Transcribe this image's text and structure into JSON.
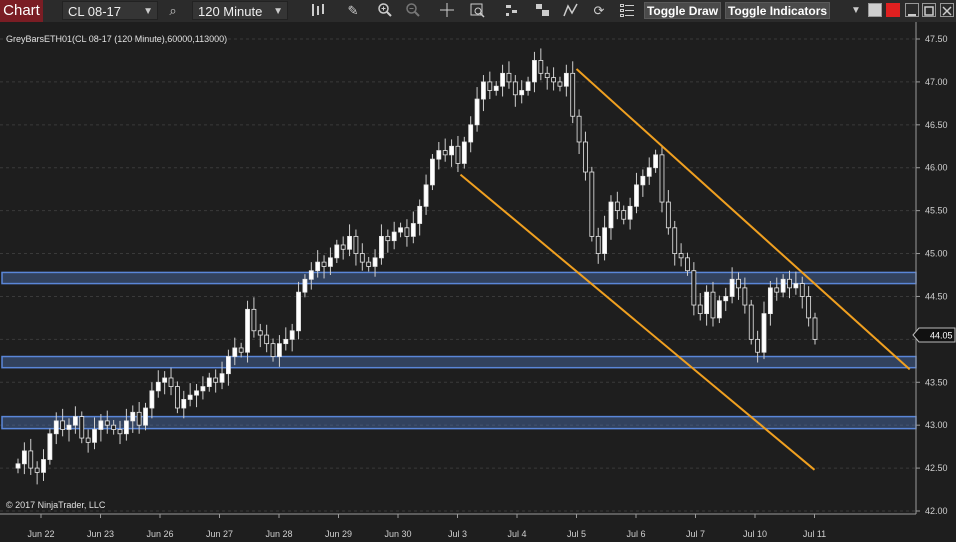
{
  "toolbar": {
    "title": "Chart",
    "instrument": "CL 08-17",
    "interval": "120 Minute",
    "toggle_draw_label": "Toggle Draw",
    "toggle_indicators_label": "Toggle Indicators"
  },
  "chart": {
    "info_label": "GreyBarsETH01(CL 08-17 (120 Minute),60000,113000)",
    "copyright": "© 2017 NinjaTrader, LLC",
    "current_price_label": "44.05",
    "colors": {
      "background": "#1e1e1e",
      "channel": "#f0a020",
      "zone": "#5a86d8",
      "candle": "#ffffff"
    }
  },
  "chart_data": {
    "type": "candlestick",
    "price_axis_labels": [
      "47.50",
      "47.00",
      "46.50",
      "46.00",
      "45.50",
      "45.00",
      "44.50",
      "44.05",
      "44.00",
      "43.50",
      "43.00",
      "42.50",
      "42.00"
    ],
    "date_labels": [
      "Jun 22",
      "Jun 23",
      "Jun 26",
      "Jun 27",
      "Jun 28",
      "Jun 29",
      "Jun 30",
      "Jul 3",
      "Jul 4",
      "Jul 5",
      "Jul 6",
      "Jul 7",
      "Jul 10",
      "Jul 11"
    ],
    "ylim": [
      42.0,
      47.6
    ],
    "current_price": 44.05,
    "zones": [
      {
        "low": 44.65,
        "high": 44.78
      },
      {
        "low": 43.67,
        "high": 43.8
      },
      {
        "low": 42.96,
        "high": 43.1
      }
    ],
    "channel_lines": [
      {
        "start": {
          "date_index": 9.0,
          "price": 47.15
        },
        "end": {
          "date_index": 14.6,
          "price": 43.65
        }
      },
      {
        "start": {
          "date_index": 7.05,
          "price": 45.92
        },
        "end": {
          "date_index": 13.0,
          "price": 42.48
        }
      }
    ],
    "closes": [
      42.55,
      42.7,
      42.5,
      42.45,
      42.6,
      42.9,
      43.05,
      42.95,
      43.0,
      43.1,
      42.85,
      42.8,
      42.95,
      43.05,
      43.0,
      42.95,
      42.9,
      43.05,
      43.15,
      43.0,
      43.2,
      43.4,
      43.5,
      43.55,
      43.45,
      43.2,
      43.3,
      43.35,
      43.4,
      43.45,
      43.55,
      43.5,
      43.6,
      43.8,
      43.9,
      43.85,
      44.35,
      44.1,
      44.05,
      43.95,
      43.8,
      43.95,
      44.0,
      44.1,
      44.55,
      44.7,
      44.8,
      44.9,
      44.85,
      44.95,
      45.1,
      45.05,
      45.2,
      45.0,
      44.9,
      44.85,
      44.95,
      45.2,
      45.15,
      45.25,
      45.3,
      45.2,
      45.35,
      45.55,
      45.8,
      46.1,
      46.2,
      46.15,
      46.25,
      46.05,
      46.3,
      46.5,
      46.8,
      47.0,
      46.9,
      46.95,
      47.1,
      47.0,
      46.85,
      46.9,
      47.0,
      47.25,
      47.1,
      47.05,
      47.0,
      46.95,
      47.1,
      46.6,
      46.3,
      45.95,
      45.2,
      45.0,
      45.3,
      45.6,
      45.5,
      45.4,
      45.55,
      45.8,
      45.9,
      46.0,
      46.15,
      45.6,
      45.3,
      45.0,
      44.95,
      44.8,
      44.4,
      44.3,
      44.55,
      44.25,
      44.45,
      44.5,
      44.7,
      44.6,
      44.4,
      44.0,
      43.85,
      44.3,
      44.6,
      44.55,
      44.7,
      44.6,
      44.65,
      44.5,
      44.25,
      44.0
    ]
  }
}
